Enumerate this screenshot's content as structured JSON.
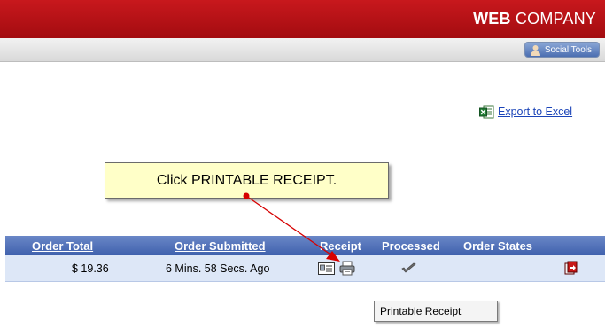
{
  "header": {
    "brand_bold": "WEB",
    "brand_rest": " COMPANY",
    "social_tools_label": "Social Tools"
  },
  "export": {
    "label": "Export to Excel",
    "icon": "excel-icon"
  },
  "callout": {
    "text": "Click PRINTABLE RECEIPT."
  },
  "table": {
    "columns": [
      {
        "label": "Order Total",
        "sortable": true
      },
      {
        "label": "Order Submitted",
        "sortable": true
      },
      {
        "label": "Receipt",
        "sortable": false
      },
      {
        "label": "Processed",
        "sortable": false
      },
      {
        "label": "Order States",
        "sortable": false
      }
    ],
    "rows": [
      {
        "order_total": "$ 19.36",
        "order_submitted": "6 Mins. 58 Secs. Ago",
        "receipt_icons": [
          "receipt-card-icon",
          "printer-icon"
        ],
        "processed_icon": "checkmark-icon",
        "order_state_icon": "order-state-icon"
      }
    ]
  },
  "tooltip": {
    "text": "Printable Receipt"
  },
  "colors": {
    "header_red": "#b51217",
    "table_header_blue": "#4a6bb5",
    "row_bg": "#dde7f7",
    "callout_bg": "#ffffc8",
    "link_blue": "#1b44b8"
  }
}
